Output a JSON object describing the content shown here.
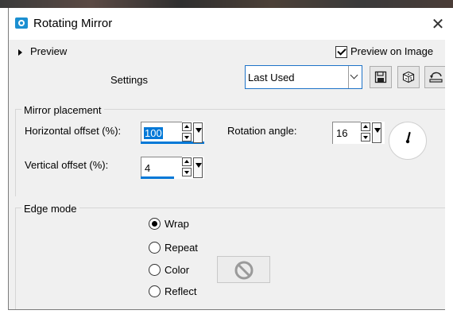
{
  "window": {
    "title": "Rotating Mirror",
    "close_glyph": "✕"
  },
  "preview": {
    "toggle_label": "Preview",
    "on_image_label": "Preview on Image",
    "on_image_checked": true
  },
  "settings": {
    "label": "Settings",
    "preset_value": "Last Used",
    "toolbar_icons": [
      "save-icon",
      "randomize-icon",
      "reset-icon"
    ]
  },
  "mirror_placement": {
    "title": "Mirror placement",
    "horizontal_label": "Horizontal offset (%):",
    "horizontal_value": "100",
    "vertical_label": "Vertical offset (%):",
    "vertical_value": "4",
    "rotation_label": "Rotation angle:",
    "rotation_value": "16"
  },
  "edge_mode": {
    "title": "Edge mode",
    "options": [
      {
        "label": "Wrap",
        "selected": true
      },
      {
        "label": "Repeat",
        "selected": false
      },
      {
        "label": "Color",
        "selected": false
      },
      {
        "label": "Reflect",
        "selected": false
      }
    ],
    "color_swatch_icon": "no-color-icon"
  },
  "colors": {
    "accent": "#0078d7",
    "dialog_bg": "#f0f0f0"
  }
}
